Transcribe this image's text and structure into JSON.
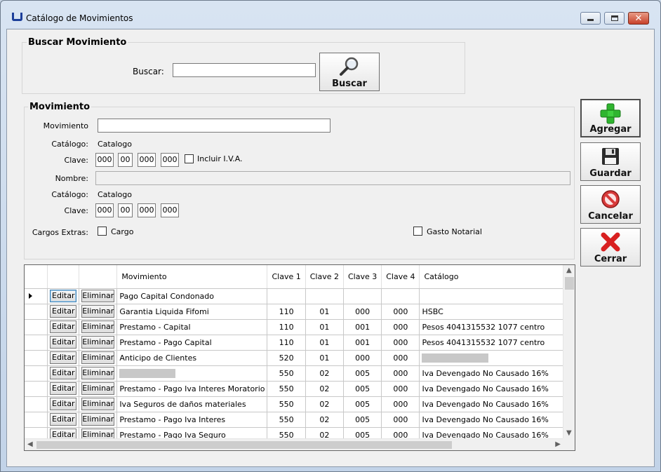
{
  "window": {
    "title": "Catálogo de Movimientos"
  },
  "search": {
    "group_title": "Buscar Movimiento",
    "label": "Buscar:",
    "value": "",
    "button_label": "Buscar"
  },
  "movimiento": {
    "group_title": "Movimiento",
    "movimiento_label": "Movimiento",
    "movimiento_value": "",
    "catalogo1_label": "Catálogo:",
    "catalogo1_value": "Catalogo",
    "clave1_label": "Clave:",
    "clave1": [
      "000",
      "00",
      "000",
      "000"
    ],
    "iva_label": "Incluir I.V.A.",
    "nombre_label": "Nombre:",
    "nombre_value": "",
    "catalogo2_label": "Catálogo:",
    "catalogo2_value": "Catalogo",
    "clave2_label": "Clave:",
    "clave2": [
      "000",
      "00",
      "000",
      "000"
    ],
    "cargos_label": "Cargos Extras:",
    "cargo_label": "Cargo",
    "gasto_label": "Gasto Notarial"
  },
  "actions": {
    "agregar": "Agregar",
    "guardar": "Guardar",
    "cancelar": "Cancelar",
    "cerrar": "Cerrar"
  },
  "grid": {
    "columns": [
      "Movimiento",
      "Clave 1",
      "Clave 2",
      "Clave 3",
      "Clave 4",
      "Catálogo"
    ],
    "edit_label": "Editar",
    "delete_label": "Eliminar",
    "rows": [
      {
        "movimiento": "Pago Capital Condonado",
        "c1": "",
        "c2": "",
        "c3": "",
        "c4": "",
        "catalogo": ""
      },
      {
        "movimiento": "Garantia Liquida Fifomi",
        "c1": "110",
        "c2": "01",
        "c3": "000",
        "c4": "000",
        "catalogo": "HSBC"
      },
      {
        "movimiento": "Prestamo - Capital",
        "c1": "110",
        "c2": "01",
        "c3": "001",
        "c4": "000",
        "catalogo": "Pesos 4041315532 1077 centro"
      },
      {
        "movimiento": "Prestamo - Pago Capital",
        "c1": "110",
        "c2": "01",
        "c3": "001",
        "c4": "000",
        "catalogo": "Pesos 4041315532 1077 centro"
      },
      {
        "movimiento": "Anticipo de Clientes",
        "c1": "520",
        "c2": "01",
        "c3": "000",
        "c4": "000",
        "catalogo": "",
        "redact_catalogo": true
      },
      {
        "movimiento": "",
        "c1": "550",
        "c2": "02",
        "c3": "005",
        "c4": "000",
        "catalogo": "Iva Devengado No Causado 16%",
        "redact_movimiento": true
      },
      {
        "movimiento": "Prestamo - Pago Iva Interes Moratorio",
        "c1": "550",
        "c2": "02",
        "c3": "005",
        "c4": "000",
        "catalogo": "Iva Devengado No Causado 16%"
      },
      {
        "movimiento": "Iva Seguros de daños materiales",
        "c1": "550",
        "c2": "02",
        "c3": "005",
        "c4": "000",
        "catalogo": "Iva Devengado No Causado 16%"
      },
      {
        "movimiento": "Prestamo - Pago Iva Interes",
        "c1": "550",
        "c2": "02",
        "c3": "005",
        "c4": "000",
        "catalogo": "Iva Devengado No Causado 16%"
      },
      {
        "movimiento": "Prestamo - Pago Iva Seguro",
        "c1": "550",
        "c2": "02",
        "c3": "005",
        "c4": "000",
        "catalogo": "Iva Devengado No Causado 16%"
      }
    ]
  },
  "icons": {
    "buscar": "magnifier-icon",
    "agregar": "plus-icon",
    "guardar": "floppy-disk-icon",
    "cancelar": "no-entry-icon",
    "cerrar": "red-x-icon"
  }
}
